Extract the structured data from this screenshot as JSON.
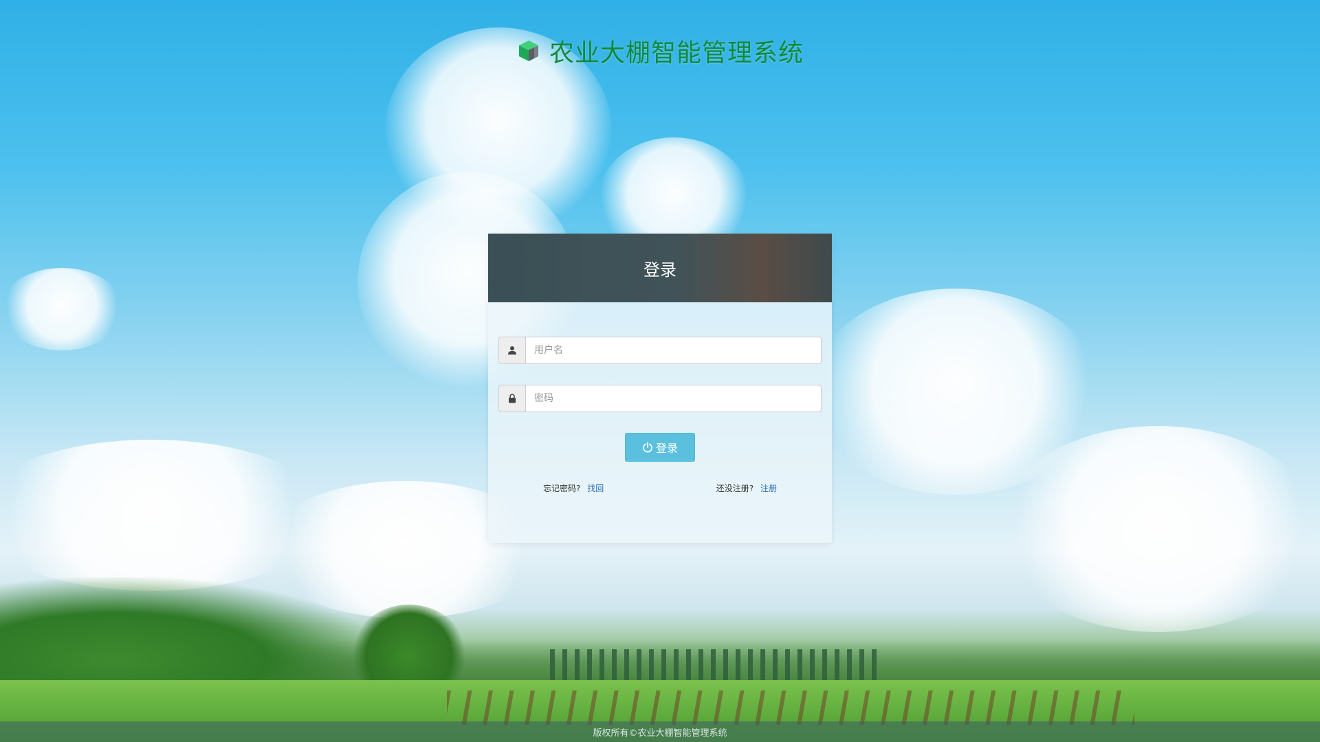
{
  "brand": {
    "title": "农业大棚智能管理系统",
    "icon": "cube-logo-icon"
  },
  "login_panel": {
    "title": "登录",
    "username": {
      "placeholder": "用户名",
      "value": "",
      "icon": "user-icon"
    },
    "password": {
      "placeholder": "密码",
      "value": "",
      "icon": "lock-icon"
    },
    "submit": {
      "label": "登录",
      "icon": "power-icon"
    },
    "forgot": {
      "prompt": "忘记密码?",
      "link": "找回"
    },
    "register": {
      "prompt": "还没注册?",
      "link": "注册"
    }
  },
  "footer": {
    "copyright": "版权所有©农业大棚智能管理系统"
  },
  "colors": {
    "brand_title": "#0f8a3a",
    "panel_header": "#3a5056",
    "button": "#5bc0de",
    "link": "#2a6fb5"
  }
}
